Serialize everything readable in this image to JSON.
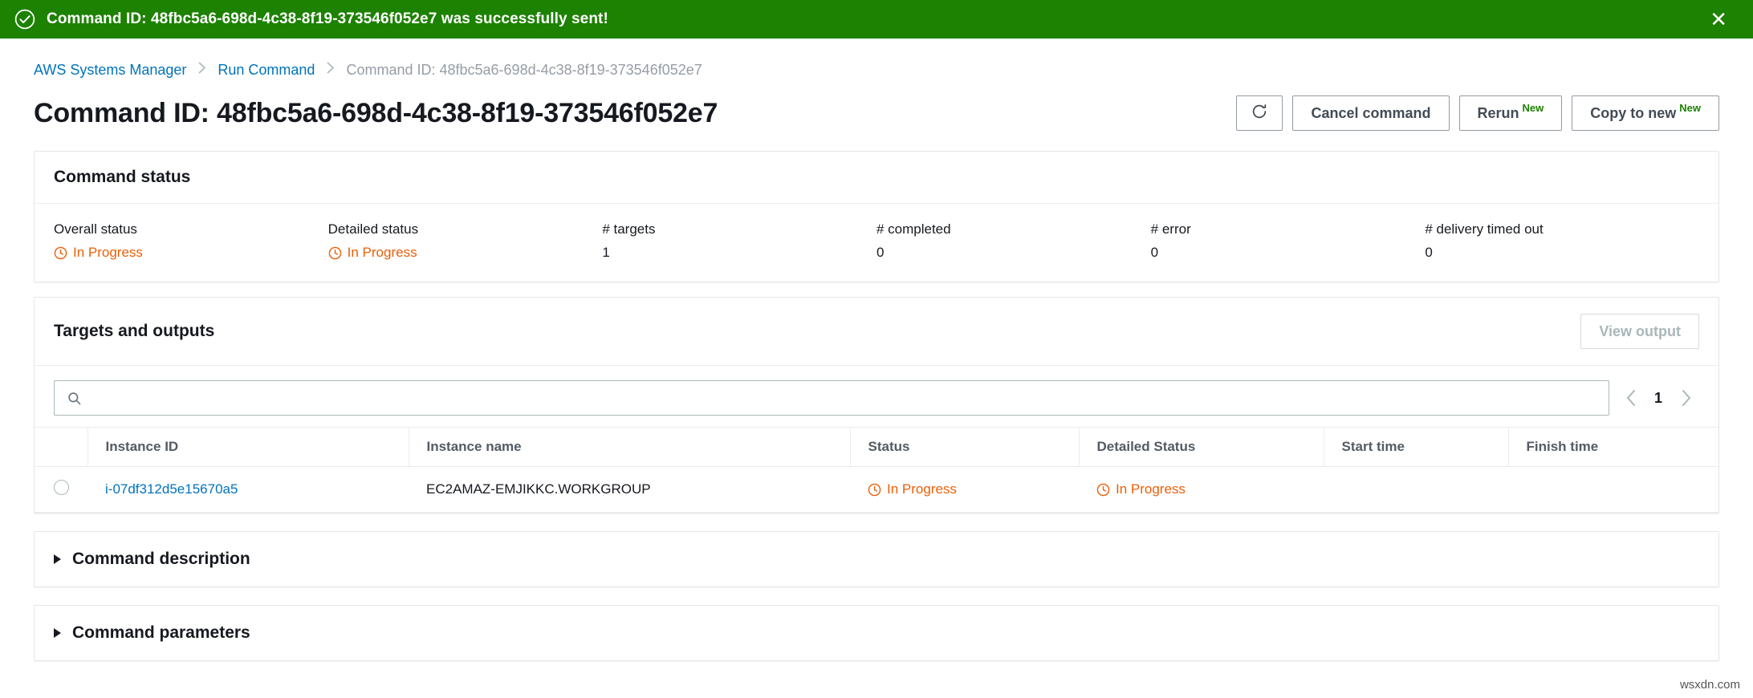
{
  "banner": {
    "icon": "check-circle-icon",
    "message": "Command ID: 48fbc5a6-698d-4c38-8f19-373546f052e7 was successfully sent!",
    "close_label": "✕",
    "background_color": "#1d8102"
  },
  "breadcrumb": {
    "items": [
      {
        "label": "AWS Systems Manager",
        "current": false
      },
      {
        "label": "Run Command",
        "current": false
      },
      {
        "label": "Command ID: 48fbc5a6-698d-4c38-8f19-373546f052e7",
        "current": true
      }
    ],
    "separator": "〉"
  },
  "header": {
    "title": "Command ID: 48fbc5a6-698d-4c38-8f19-373546f052e7",
    "actions": {
      "refresh_icon": "refresh-icon",
      "cancel_label": "Cancel command",
      "rerun_label": "Rerun",
      "rerun_badge": "New",
      "copy_label": "Copy to new",
      "copy_badge": "New"
    }
  },
  "command_status": {
    "title": "Command status",
    "fields": [
      {
        "label": "Overall status",
        "value": "In Progress",
        "status": true
      },
      {
        "label": "Detailed status",
        "value": "In Progress",
        "status": true
      },
      {
        "label": "# targets",
        "value": "1",
        "status": false
      },
      {
        "label": "# completed",
        "value": "0",
        "status": false
      },
      {
        "label": "# error",
        "value": "0",
        "status": false
      },
      {
        "label": "# delivery timed out",
        "value": "0",
        "status": false
      }
    ]
  },
  "targets": {
    "title": "Targets and outputs",
    "view_output_label": "View output",
    "view_output_disabled": true,
    "search": {
      "value": "",
      "placeholder": "",
      "icon": "search-icon"
    },
    "pagination": {
      "prev_icon": "chevron-left-icon",
      "next_icon": "chevron-right-icon",
      "current_page": "1"
    },
    "columns": [
      "Instance ID",
      "Instance name",
      "Status",
      "Detailed Status",
      "Start time",
      "Finish time"
    ],
    "rows": [
      {
        "selected": false,
        "instance_id": "i-07df312d5e15670a5",
        "instance_name": "EC2AMAZ-EMJIKKC.WORKGROUP",
        "status": "In Progress",
        "detailed_status": "In Progress",
        "start_time": "",
        "finish_time": ""
      }
    ]
  },
  "sections": [
    {
      "title": "Command description",
      "expanded": false
    },
    {
      "title": "Command parameters",
      "expanded": false
    }
  ],
  "watermark": "wsxdn.com",
  "colors": {
    "success_green": "#1d8102",
    "link_blue": "#0073bb",
    "in_progress_orange": "#eb5f07",
    "text_dark": "#16191f",
    "muted": "#969da5"
  }
}
